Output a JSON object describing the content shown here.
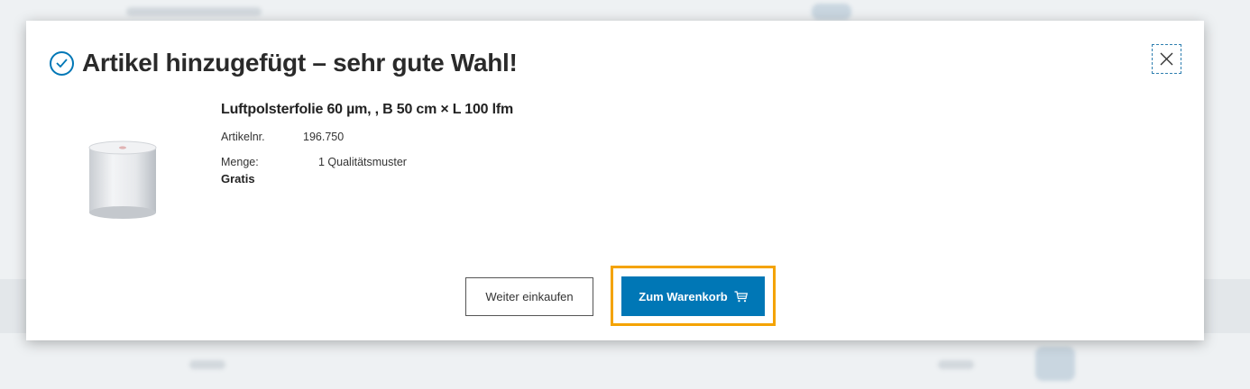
{
  "modal": {
    "title": "Artikel hinzugefügt – sehr gute Wahl!",
    "icons": {
      "title": "check-circle-icon",
      "close": "close-icon",
      "cart": "cart-icon"
    },
    "product": {
      "name": "Luftpolsterfolie 60 µm, , B 50 cm × L 100 lfm",
      "article_label": "Artikelnr.",
      "article_value": "196.750",
      "quantity_label": "Menge:",
      "quantity_value": "1 Qualitätsmuster",
      "price": "Gratis"
    },
    "buttons": {
      "continue_label": "Weiter einkaufen",
      "cart_label": "Zum Warenkorb"
    }
  },
  "colors": {
    "accent": "#0077b6",
    "focus": "#f4a300"
  }
}
